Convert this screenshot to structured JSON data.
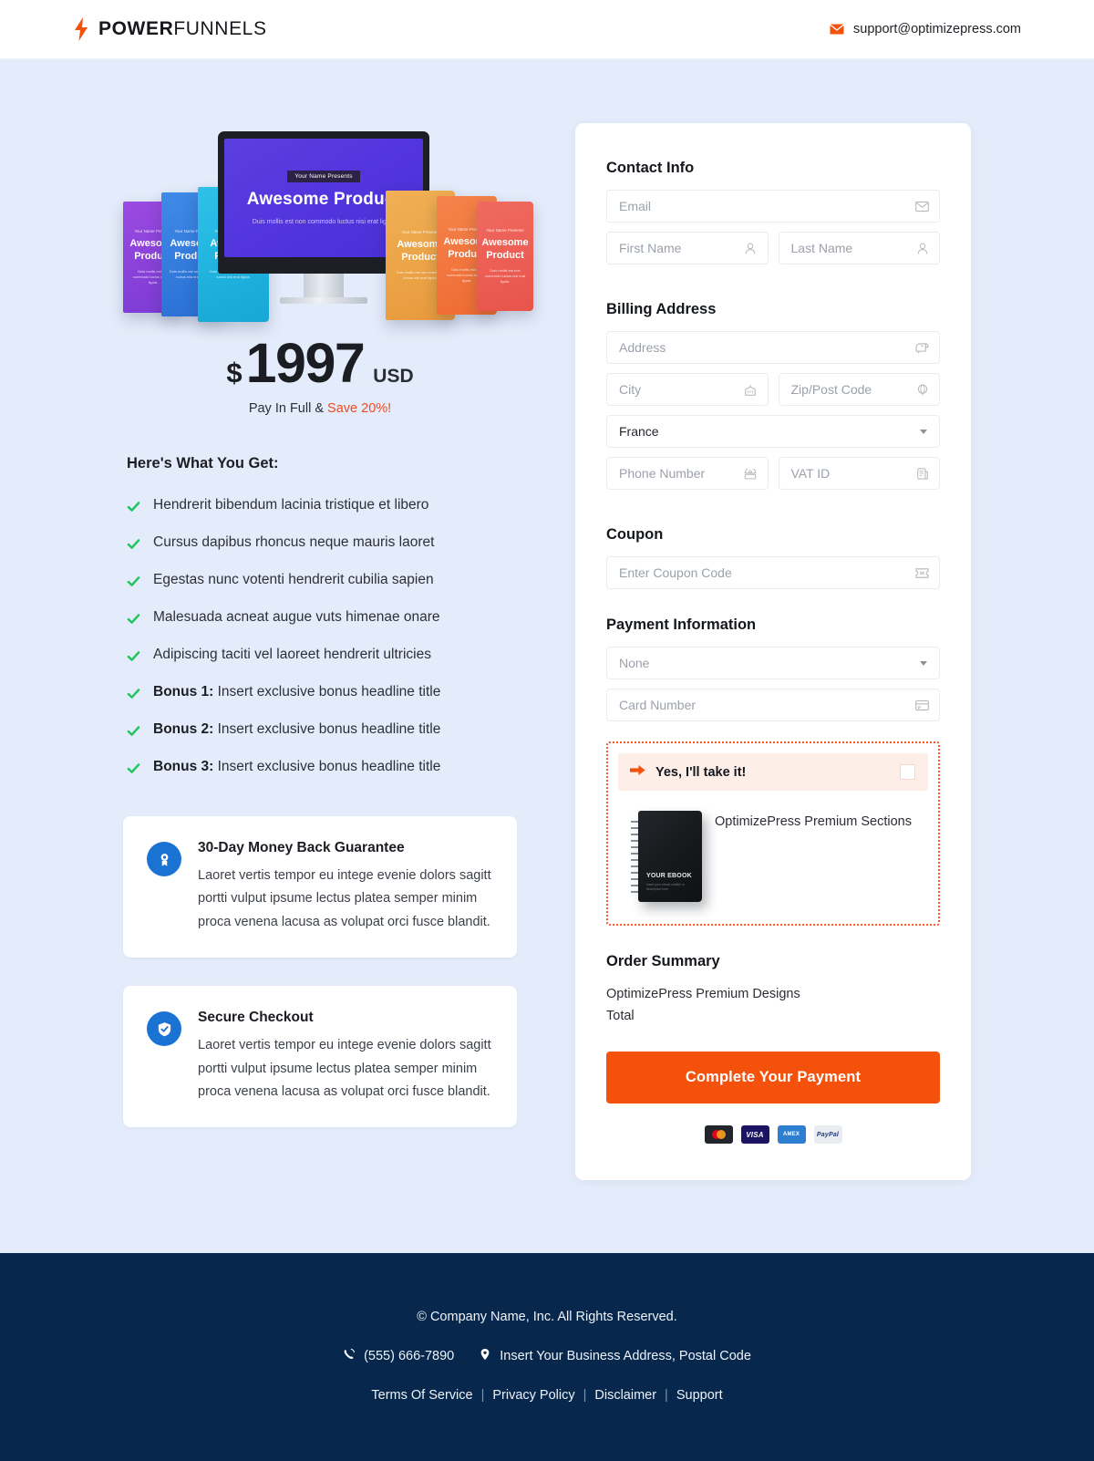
{
  "header": {
    "brand_bold": "POWER",
    "brand_light": "FUNNELS",
    "bolt_icon": "lightning-bolt-icon",
    "mail_icon": "envelope-icon",
    "support_email": "support@optimizepress.com",
    "accent_color": "#f4510d"
  },
  "product": {
    "screen_badge": "Your Name Presents",
    "screen_title": "Awesome Product",
    "screen_sub": "Duis mollis est non commodo luctus nisi erat ligula",
    "book_pre": "Your Name Presents",
    "book_title": "Awesome Product",
    "book_desc": "Duis mollis est non commodo luctus nisi erat ligula.",
    "books": [
      {
        "color1": "#7b3bd4",
        "color2": "#9b4ae0"
      },
      {
        "color1": "#2a6fd4",
        "color2": "#3f8ae8"
      },
      {
        "color1": "#16a7d6",
        "color2": "#2ec2e8"
      },
      {
        "color1": "#e89a3c",
        "color2": "#f0b055"
      },
      {
        "color1": "#ef6b33",
        "color2": "#f5834b"
      },
      {
        "color1": "#e8544a",
        "color2": "#f06a60"
      }
    ]
  },
  "price": {
    "currency_symbol": "$",
    "amount": "1997",
    "currency_code": "USD",
    "note_prefix": "Pay In Full & ",
    "note_save": "Save 20%!",
    "save_color": "#ee4a22"
  },
  "features": {
    "title": "Here's What You Get:",
    "check_icon": "check-icon",
    "check_color": "#22c55e",
    "items": [
      {
        "bold": "",
        "text": "Hendrerit bibendum lacinia tristique et libero"
      },
      {
        "bold": "",
        "text": "Cursus dapibus rhoncus neque mauris laoret"
      },
      {
        "bold": "",
        "text": "Egestas nunc votenti hendrerit cubilia sapien"
      },
      {
        "bold": "",
        "text": "Malesuada acneat augue vuts himenae onare"
      },
      {
        "bold": "",
        "text": "Adipiscing taciti vel laoreet hendrerit ultricies"
      },
      {
        "bold": "Bonus 1:",
        "text": " Insert exclusive bonus headline title"
      },
      {
        "bold": "Bonus 2:",
        "text": " Insert exclusive bonus headline title"
      },
      {
        "bold": "Bonus 3:",
        "text": " Insert exclusive bonus headline title"
      }
    ]
  },
  "info_cards": [
    {
      "icon": "award-badge-icon",
      "title": "30-Day Money Back Guarantee",
      "body": "Laoret vertis tempor eu intege evenie dolors sagitt portti vulput ipsume lectus platea semper minim proca venena lacusa as volupat orci fusce blandit.",
      "icon_color": "#1a73d2"
    },
    {
      "icon": "shield-check-icon",
      "title": "Secure Checkout",
      "body": "Laoret vertis tempor eu intege evenie dolors sagitt portti vulput ipsume lectus platea semper minim proca venena lacusa as volupat orci fusce blandit.",
      "icon_color": "#1a73d2"
    }
  ],
  "checkout": {
    "contact": {
      "title": "Contact Info",
      "email_placeholder": "Email",
      "email_icon": "envelope-icon",
      "first_name_placeholder": "First Name",
      "first_name_icon": "user-icon",
      "last_name_placeholder": "Last Name",
      "last_name_icon": "user-icon"
    },
    "billing": {
      "title": "Billing Address",
      "address_placeholder": "Address",
      "address_icon": "mailbox-icon",
      "city_placeholder": "City",
      "city_icon": "building-icon",
      "zip_placeholder": "Zip/Post Code",
      "zip_icon": "globe-icon",
      "country_value": "France",
      "country_icon": "chevron-down-icon",
      "phone_placeholder": "Phone Number",
      "phone_icon": "telephone-icon",
      "vat_placeholder": "VAT ID",
      "vat_icon": "document-icon"
    },
    "coupon": {
      "title": "Coupon",
      "placeholder": "Enter Coupon Code",
      "icon": "ticket-icon"
    },
    "payment": {
      "title": "Payment Information",
      "method_value": "None",
      "method_icon": "chevron-down-icon",
      "card_placeholder": "Card Number",
      "card_icon": "credit-card-icon"
    },
    "bump": {
      "arrow_icon": "arrow-right-icon",
      "label": "Yes, I'll take it!",
      "checkbox": "order-bump-checkbox",
      "ebook_title": "YOUR EBOOK",
      "ebook_sub": "Insert your ebook subtitle or description here",
      "description": "OptimizePress Premium Sections",
      "border_color": "#f05a28",
      "header_bg": "#fdeee8"
    },
    "summary": {
      "title": "Order Summary",
      "rows": [
        {
          "label": "OptimizePress Premium Designs",
          "value": ""
        },
        {
          "label": "Total",
          "value": ""
        }
      ]
    },
    "submit_label": "Complete Your Payment",
    "submit_color": "#f4510d",
    "payment_badges": [
      {
        "name": "mastercard-badge",
        "label": ""
      },
      {
        "name": "visa-badge",
        "label": "VISA"
      },
      {
        "name": "amex-badge",
        "label": "AMEX"
      },
      {
        "name": "paypal-badge",
        "label": "PayPal"
      }
    ]
  },
  "footer": {
    "copyright": "© Company Name, Inc. All Rights Reserved.",
    "phone_icon": "phone-icon",
    "phone": "(555) 666-7890",
    "location_icon": "map-pin-icon",
    "address": "Insert Your Business Address, Postal Code",
    "links": [
      "Terms Of Service",
      "Privacy Policy",
      "Disclaimer",
      "Support"
    ],
    "separator": "|",
    "bg_color": "#07274c"
  }
}
